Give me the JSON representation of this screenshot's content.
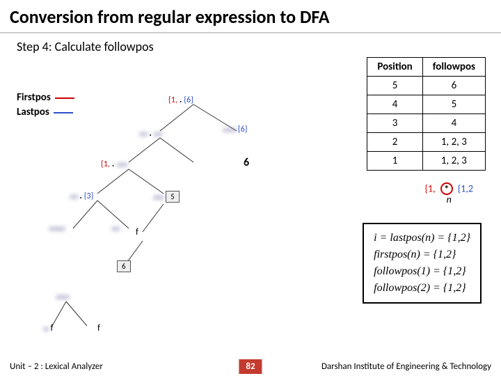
{
  "title": "Conversion from regular expression to DFA",
  "step": "Step 4: Calculate followpos",
  "legend": {
    "first": "Firstpos",
    "last": "Lastpos"
  },
  "table": {
    "headers": [
      "Position",
      "followpos"
    ],
    "rows": [
      [
        "5",
        "6"
      ],
      [
        "4",
        "5"
      ],
      [
        "3",
        "4"
      ],
      [
        "2",
        "1, 2, 3"
      ],
      [
        "1",
        "1, 2, 3"
      ]
    ]
  },
  "tree": {
    "n1": {
      "l": "{1,",
      "op": ".",
      "r": "{6}"
    },
    "n2": {
      "op": ".",
      "r": "{6}"
    },
    "n3": {
      "op": "."
    },
    "n4": {
      "l": "{1,",
      "op": ".",
      "r": "{3}",
      "box": "5"
    },
    "n5": {
      "op": "f",
      "box": "6"
    },
    "n6": {
      "op": "f"
    },
    "n7": {
      "op": "f"
    },
    "rlab": "6"
  },
  "star": {
    "l": "{1,",
    "op": "*",
    "r": "{1,2",
    "n": "n"
  },
  "eq": {
    "l1": "i = lastpos(n) = {1,2}",
    "l2": "firstpos(n) = {1,2}",
    "l3": "followpos(1) = {1,2}",
    "l4": "followpos(2) = {1,2}"
  },
  "footer": {
    "unit": "Unit – 2  : Lexical Analyzer",
    "page": "82",
    "inst": "Darshan Institute of Engineering & Technology"
  }
}
